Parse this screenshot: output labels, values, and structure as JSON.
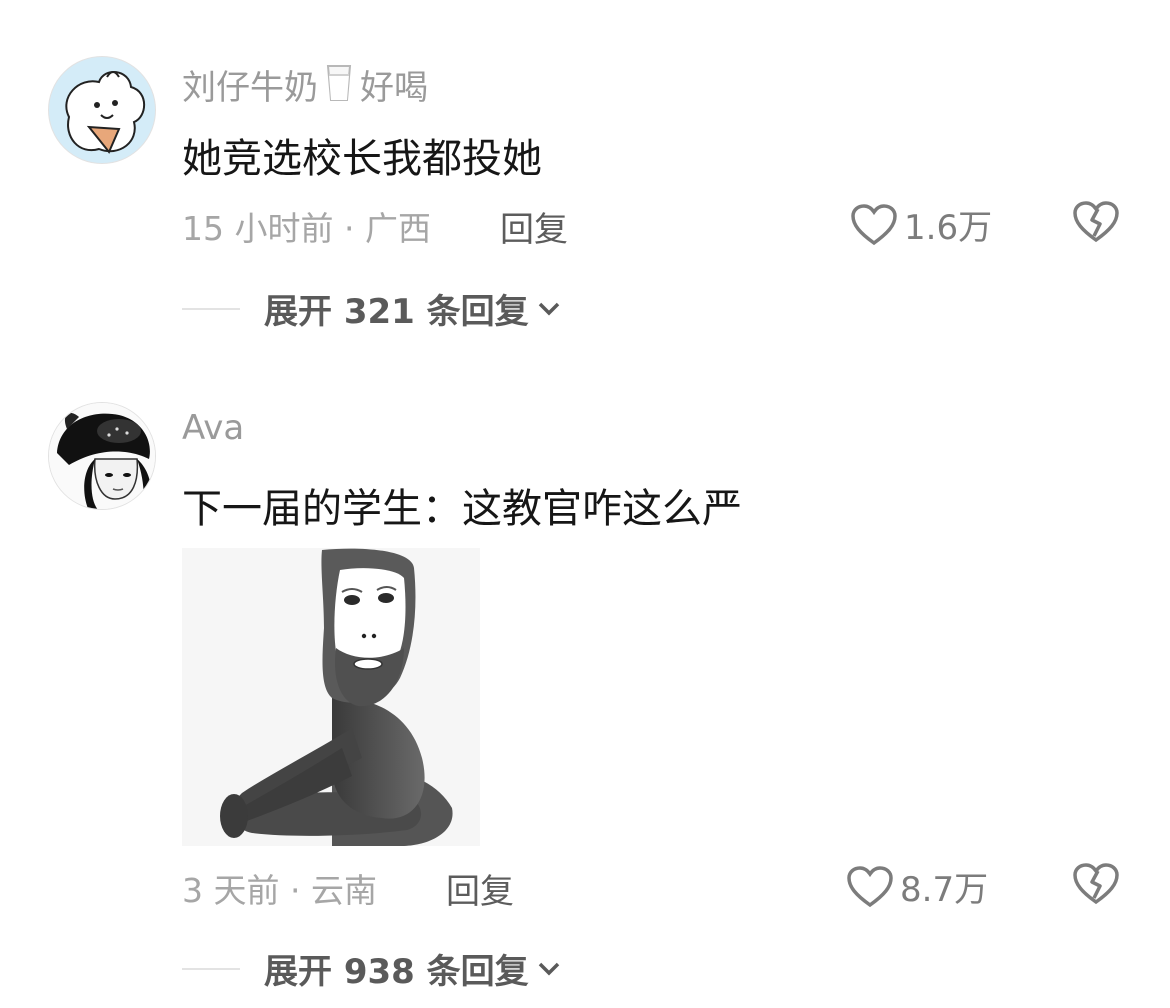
{
  "comments": [
    {
      "username": "刘仔牛奶",
      "username_suffix": "好喝",
      "username_emoji": "milk-glass-icon",
      "text": "她竞选校长我都投她",
      "meta": "15 小时前 · 广西",
      "reply_label": "回复",
      "likes": "1.6万",
      "expand_label": "展开 321 条回复"
    },
    {
      "username": "Ava",
      "text": "下一届的学生：这教官咋这么严",
      "meta": "3 天前 · 云南",
      "reply_label": "回复",
      "likes": "8.7万",
      "expand_label": "展开 938 条回复"
    }
  ],
  "colors": {
    "username": "#9a9a9a",
    "text": "#161616",
    "meta": "#a6a6a6",
    "icon": "#7c7c7c",
    "avatar1_bg": "#d4ecf8"
  }
}
